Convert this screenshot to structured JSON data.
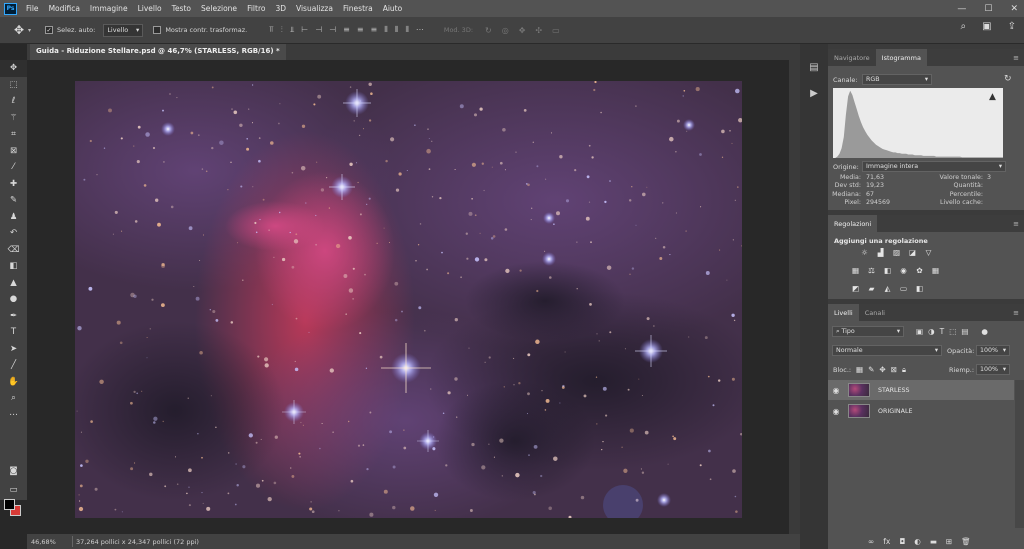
{
  "app": {
    "logo": "Ps"
  },
  "menubar": {
    "items": [
      "File",
      "Modifica",
      "Immagine",
      "Livello",
      "Testo",
      "Selezione",
      "Filtro",
      "3D",
      "Visualizza",
      "Finestra",
      "Aiuto"
    ]
  },
  "window_controls": {
    "minimize": "—",
    "maximize": "☐",
    "close": "✕"
  },
  "options_bar": {
    "auto_select_label": "Selez. auto:",
    "auto_select_value": "Livello",
    "transform_label": "Mostra contr. trasformaz.",
    "mode3d_label": "Mod. 3D:"
  },
  "document": {
    "tab_title": "Guida - Riduzione Stellare.psd @ 46,7% (STARLESS, RGB/16)",
    "tab_marker": "*"
  },
  "status": {
    "zoom": "46,68%",
    "dimensions": "37,264 pollici x 24,347 pollici (72 ppi)"
  },
  "histogram_panel": {
    "tabs": [
      "Navigatore",
      "Istogramma"
    ],
    "active_tab": "Istogramma",
    "channel_label": "Canale:",
    "channel_value": "RGB",
    "source_label": "Origine:",
    "source_value": "Immagine intera",
    "stats_labels": [
      "Media:",
      "Dev std:",
      "Mediana:",
      "Pixel:"
    ],
    "stats_values": [
      "71,63",
      "19,23",
      "67",
      "294569"
    ],
    "stats2_labels": [
      "Valore tonale:",
      "Quantità:",
      "Percentile:",
      "Livello cache:"
    ],
    "stats2_values": [
      "",
      "",
      "",
      "3"
    ],
    "curve": [
      0,
      0,
      2,
      6,
      14,
      30,
      62,
      88,
      96,
      90,
      80,
      70,
      60,
      51,
      44,
      38,
      33,
      29,
      25,
      22,
      19,
      17,
      15,
      13,
      12,
      11,
      10,
      9,
      8,
      8,
      7,
      7,
      6,
      6,
      6,
      5,
      5,
      5,
      4,
      4,
      4,
      4,
      3,
      3,
      3,
      3,
      3,
      3,
      2,
      2,
      2,
      2,
      2,
      2,
      2,
      2,
      2,
      2,
      2,
      2,
      1,
      1,
      1,
      1,
      1,
      1,
      1,
      1,
      1,
      1,
      1,
      1,
      1,
      1,
      1,
      1,
      1,
      1,
      1,
      1
    ]
  },
  "adjustments_panel": {
    "title": "Regolazioni",
    "add_label": "Aggiungi una regolazione"
  },
  "layers_panel": {
    "tabs": [
      "Livelli",
      "Canali"
    ],
    "filter_value": "Tipo",
    "blend_value": "Normale",
    "opacity_label": "Opacità:",
    "opacity_value": "100%",
    "lock_label": "Bloc.:",
    "fill_label": "Riemp.:",
    "fill_value": "100%",
    "layers": [
      {
        "name": "STARLESS",
        "selected": true
      },
      {
        "name": "ORIGINALE",
        "selected": false
      }
    ]
  },
  "colors": {
    "foreground": "#000000",
    "background": "#d73a36",
    "accent": "#31a8ff"
  }
}
